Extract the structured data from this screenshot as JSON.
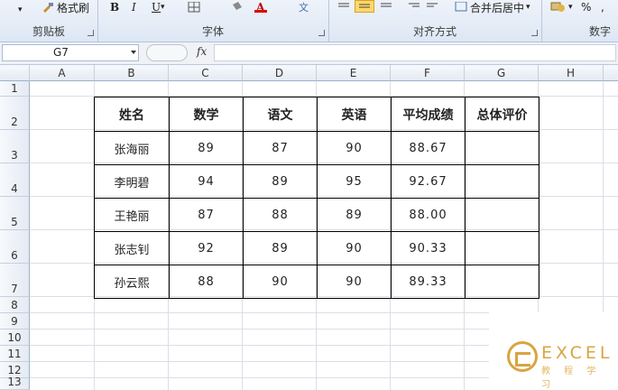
{
  "ribbon": {
    "format_painter_label": "格式刷",
    "merge_center_label": "合并后居中",
    "percent_label": "%",
    "groups": {
      "clipboard": "剪贴板",
      "font": "字体",
      "alignment": "对齐方式",
      "number": "数字"
    }
  },
  "formula_bar": {
    "name_box": "G7",
    "fx": "fx",
    "formula": ""
  },
  "columns": [
    "A",
    "B",
    "C",
    "D",
    "E",
    "F",
    "G",
    "H"
  ],
  "rows": [
    "1",
    "2",
    "3",
    "4",
    "5",
    "6",
    "7",
    "8",
    "9",
    "10",
    "11",
    "12",
    "13"
  ],
  "table": {
    "headers": [
      "姓名",
      "数学",
      "语文",
      "英语",
      "平均成绩",
      "总体评价"
    ],
    "rows": [
      [
        "张海丽",
        "89",
        "87",
        "90",
        "88.67",
        ""
      ],
      [
        "李明碧",
        "94",
        "89",
        "95",
        "92.67",
        ""
      ],
      [
        "王艳丽",
        "87",
        "88",
        "89",
        "88.00",
        ""
      ],
      [
        "张志钊",
        "92",
        "89",
        "90",
        "90.33",
        ""
      ],
      [
        "孙云熙",
        "88",
        "90",
        "90",
        "89.33",
        ""
      ]
    ]
  },
  "watermark": {
    "brand": "EXCEL",
    "sub": "教 程 学 习"
  }
}
